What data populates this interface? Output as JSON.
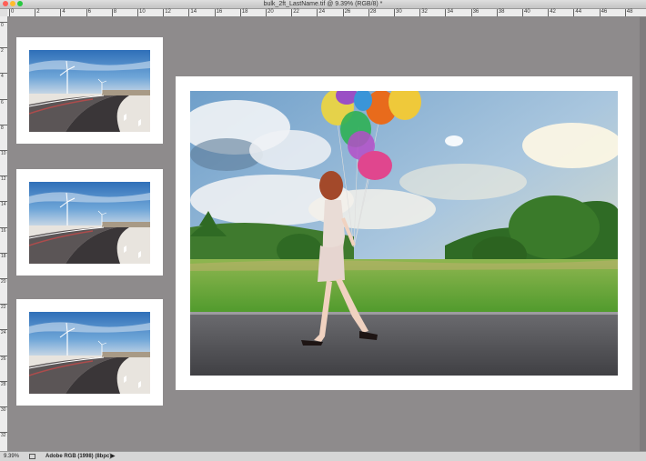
{
  "window": {
    "title": "bulk_2ft_LastName.tif @ 9.39% (RGB/8) *",
    "traffic_lights": [
      "#ff5f57",
      "#febc2e",
      "#28c840"
    ]
  },
  "ruler": {
    "top_labels": [
      "0",
      "2",
      "4",
      "6",
      "8",
      "10",
      "12",
      "14",
      "16",
      "18",
      "20",
      "22",
      "24",
      "26",
      "28",
      "30",
      "32",
      "34",
      "36",
      "38",
      "40",
      "42",
      "44",
      "46",
      "48"
    ],
    "left_labels": [
      "0",
      "2",
      "4",
      "6",
      "8",
      "10",
      "12",
      "14",
      "16",
      "18",
      "20",
      "22",
      "24",
      "26",
      "28",
      "30",
      "32"
    ]
  },
  "status": {
    "zoom": "9.39%",
    "profile": "Adobe RGB (1998) (8bpc)"
  },
  "colors": {
    "pasteboard": "#8e8b8c",
    "paper": "#ffffff",
    "sky": "#3d7fc4",
    "road": "#3c3c3e",
    "grass": "#5a9a30"
  },
  "thumbnails": [
    {
      "name": "windmill-road-photo"
    },
    {
      "name": "windmill-road-photo"
    },
    {
      "name": "windmill-road-photo"
    }
  ],
  "main_image": {
    "name": "girl-with-balloons-photo"
  }
}
